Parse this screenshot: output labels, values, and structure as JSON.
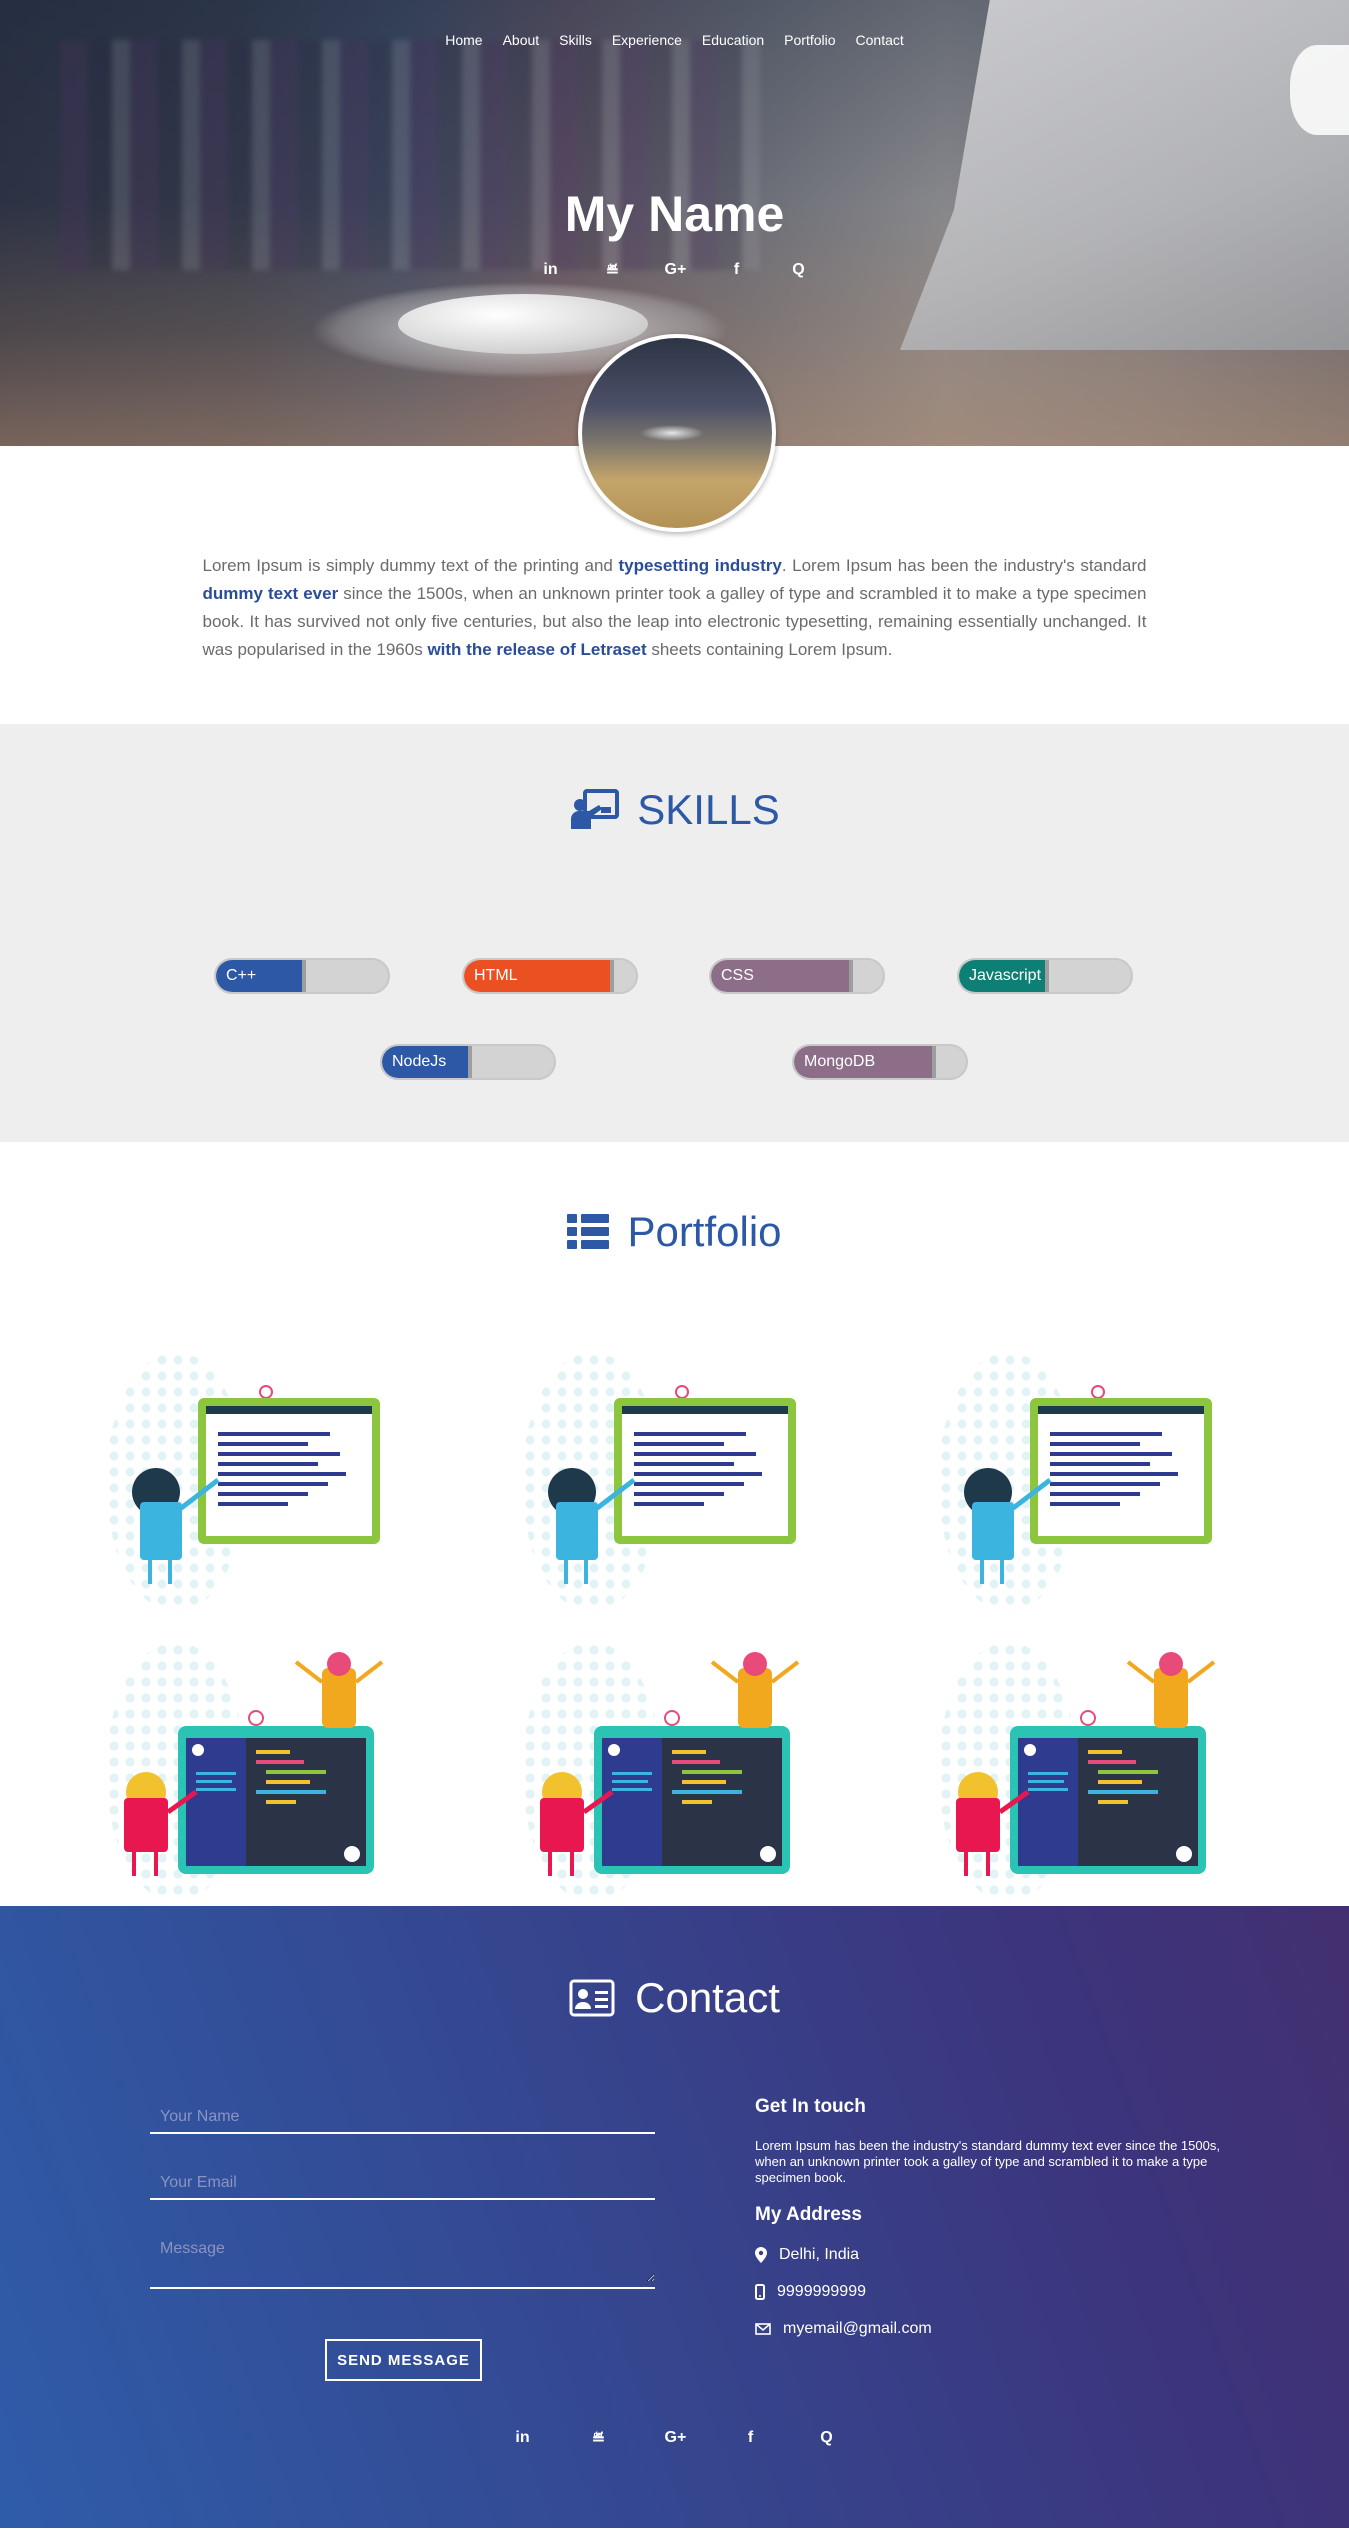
{
  "nav": [
    "Home",
    "About",
    "Skills",
    "Experience",
    "Education",
    "Portfolio",
    "Contact"
  ],
  "hero": {
    "title": "My Name",
    "social": [
      {
        "icon": "linkedin-icon",
        "glyph": "in"
      },
      {
        "icon": "stack-overflow-icon",
        "glyph": "≝"
      },
      {
        "icon": "google-plus-icon",
        "glyph": "G+"
      },
      {
        "icon": "facebook-icon",
        "glyph": "f"
      },
      {
        "icon": "quora-icon",
        "glyph": "Q"
      }
    ]
  },
  "about": {
    "segments": [
      {
        "text": "Lorem Ipsum is simply dummy text of the printing and ",
        "bold": false
      },
      {
        "text": "typesetting industry",
        "bold": true
      },
      {
        "text": ". Lorem Ipsum has been the industry's standard ",
        "bold": false
      },
      {
        "text": "dummy text ever",
        "bold": true
      },
      {
        "text": " since the 1500s, when an unknown printer took a galley of type and scrambled it to make a type specimen book. It has survived not only five centuries, but also the leap into electronic typesetting, remaining essentially unchanged. It was popularised in the 1960s ",
        "bold": false
      },
      {
        "text": "with the release of Letraset",
        "bold": true
      },
      {
        "text": " sheets containing Lorem Ipsum.",
        "bold": false
      }
    ]
  },
  "skills": {
    "title": "SKILLS",
    "icon": "teacher-board-icon",
    "items": [
      {
        "name": "C++",
        "level": 0.5,
        "color": "#2c58a5"
      },
      {
        "name": "HTML",
        "level": 0.85,
        "color": "#ea5022"
      },
      {
        "name": "CSS",
        "level": 0.8,
        "color": "#8d6e88"
      },
      {
        "name": "Javascript",
        "level": 0.5,
        "color": "#0e7f74"
      },
      {
        "name": "NodeJs",
        "level": 0.5,
        "color": "#2c58a5"
      },
      {
        "name": "MongoDB",
        "level": 0.8,
        "color": "#8d6e88"
      }
    ]
  },
  "portfolio": {
    "title": "Portfolio",
    "icon": "list-icon",
    "works": [
      {
        "kind": "whiteboard"
      },
      {
        "kind": "whiteboard"
      },
      {
        "kind": "whiteboard"
      },
      {
        "kind": "code-editor"
      },
      {
        "kind": "code-editor"
      },
      {
        "kind": "code-editor"
      }
    ]
  },
  "contact": {
    "title": "Contact",
    "icon": "contact-card-icon",
    "form": {
      "name_placeholder": "Your Name",
      "email_placeholder": "Your Email",
      "message_placeholder": "Message",
      "send_label": "SEND MESSAGE"
    },
    "get_in_touch": {
      "heading": "Get In touch",
      "text": "Lorem Ipsum has been the industry's standard dummy text ever since the 1500s, when an unknown printer took a galley of type and scrambled it to make a type specimen book."
    },
    "address": {
      "heading": "My Address",
      "location": "Delhi, India",
      "phone": "9999999999",
      "email": "myemail@gmail.com"
    }
  },
  "colors": {
    "accent": "#2c58a5",
    "contact_gradient_start": "#2f5ca9",
    "contact_gradient_end": "#433070"
  }
}
